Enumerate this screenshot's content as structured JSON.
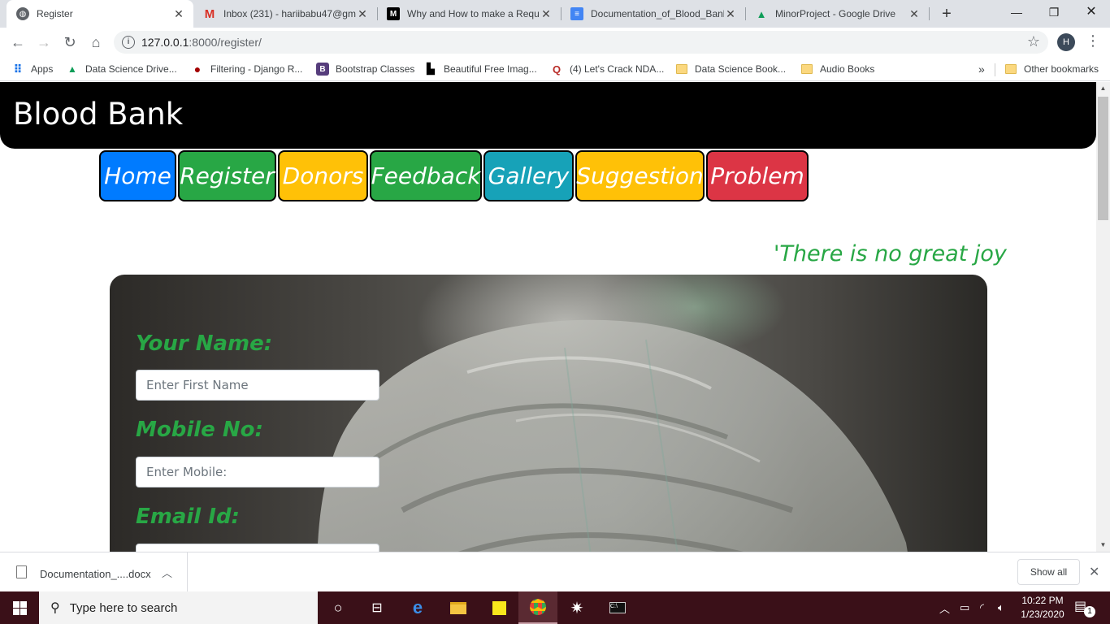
{
  "browser": {
    "tabs": [
      {
        "title": "Register",
        "icon": "globe-icon",
        "active": true
      },
      {
        "title": "Inbox (231) - hariibabu47@gm",
        "icon": "gmail-icon"
      },
      {
        "title": "Why and How to make a Requ",
        "icon": "medium-icon"
      },
      {
        "title": "Documentation_of_Blood_Bank",
        "icon": "google-docs-icon"
      },
      {
        "title": "MinorProject - Google Drive",
        "icon": "google-drive-icon"
      }
    ],
    "address": {
      "host": "127.0.0.1",
      "path": ":8000/register/"
    },
    "profile_initial": "H",
    "bookmarks": [
      {
        "label": "Apps"
      },
      {
        "label": "Data Science Drive..."
      },
      {
        "label": "Filtering - Django R..."
      },
      {
        "label": "Bootstrap Classes"
      },
      {
        "label": "Beautiful Free Imag..."
      },
      {
        "label": "(4) Let's Crack NDA..."
      },
      {
        "label": "Data Science Book..."
      },
      {
        "label": "Audio Books"
      }
    ],
    "bookmarks_overflow": "»",
    "other_bookmarks": "Other bookmarks"
  },
  "site": {
    "brand": "Blood Bank",
    "nav": [
      {
        "label": "Home",
        "color": "#007bff"
      },
      {
        "label": "Register",
        "color": "#28a745"
      },
      {
        "label": "Donors",
        "color": "#ffc107"
      },
      {
        "label": "Feedback",
        "color": "#28a745"
      },
      {
        "label": "Gallery",
        "color": "#17a2b8"
      },
      {
        "label": "Suggestion",
        "color": "#ffc107"
      },
      {
        "label": "Problem",
        "color": "#dc3545"
      }
    ],
    "quote": "'There is no great joy",
    "form": {
      "name_label": "Your Name:",
      "name_placeholder": "Enter First Name",
      "mobile_label": "Mobile No:",
      "mobile_placeholder": "Enter Mobile:",
      "email_label": "Email Id:"
    },
    "accent_green": "#28a745"
  },
  "downloads": {
    "file_name": "Documentation_....docx",
    "show_all": "Show all"
  },
  "taskbar": {
    "search_placeholder": "Type here to search",
    "time": "10:22 PM",
    "date": "1/23/2020",
    "notification_count": "1"
  }
}
